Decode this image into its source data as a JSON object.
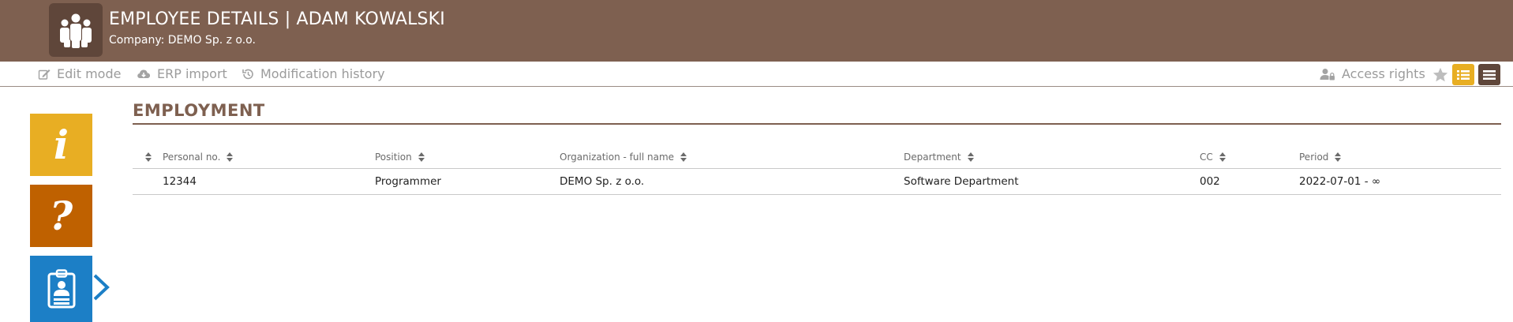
{
  "header": {
    "title": "EMPLOYEE DETAILS | ADAM KOWALSKI",
    "subtitle": "Company: DEMO Sp. z o.o.",
    "logo_icon": "people-group-icon"
  },
  "toolbar": {
    "edit_mode_label": "Edit mode",
    "erp_import_label": "ERP import",
    "modification_history_label": "Modification history",
    "access_rights_label": "Access rights"
  },
  "sidebar": {
    "info_glyph": "i",
    "help_glyph": "?"
  },
  "section": {
    "title": "EMPLOYMENT"
  },
  "table": {
    "columns": [
      "Personal no.",
      "Position",
      "Organization - full name",
      "Department",
      "CC",
      "Period"
    ],
    "rows": [
      [
        "12344",
        "Programmer",
        "DEMO Sp. z o.o.",
        "Software Department",
        "002",
        "2022-07-01 - ∞"
      ]
    ]
  },
  "colors": {
    "brand_brown": "#7e6050",
    "accent_yellow": "#e8ae23",
    "accent_orange": "#bf6100",
    "accent_blue": "#1c7fc6"
  }
}
